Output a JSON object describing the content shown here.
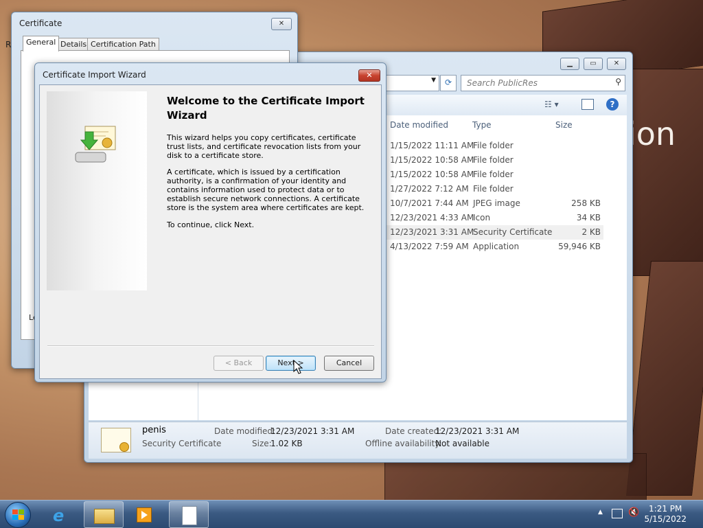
{
  "wallpaper": {
    "text": "ion"
  },
  "explorer": {
    "search_placeholder": "Search PublicRes",
    "columns": {
      "date": "Date modified",
      "type": "Type",
      "size": "Size"
    },
    "rows": [
      {
        "date": "1/15/2022 11:11 AM",
        "type": "File folder",
        "size": ""
      },
      {
        "date": "1/15/2022 10:58 AM",
        "type": "File folder",
        "size": ""
      },
      {
        "date": "1/15/2022 10:58 AM",
        "type": "File folder",
        "size": ""
      },
      {
        "date": "1/27/2022 7:12 AM",
        "type": "File folder",
        "size": ""
      },
      {
        "date": "10/7/2021 7:44 AM",
        "type": "JPEG image",
        "size": "258 KB"
      },
      {
        "date": "12/23/2021 4:33 AM",
        "type": "Icon",
        "size": "34 KB"
      },
      {
        "date": "12/23/2021 3:31 AM",
        "type": "Security Certificate",
        "size": "2 KB"
      },
      {
        "date": "4/13/2022 7:59 AM",
        "type": "Application",
        "size": "59,946 KB"
      }
    ],
    "details": {
      "name": "penis",
      "type": "Security Certificate",
      "date_modified_label": "Date modified:",
      "date_modified": "12/23/2021 3:31 AM",
      "size_label": "Size:",
      "size": "1.02 KB",
      "date_created_label": "Date created:",
      "date_created": "12/23/2021 3:31 AM",
      "offline_label": "Offline availability:",
      "offline": "Not available"
    }
  },
  "cert_dialog": {
    "title": "Certificate",
    "tabs": [
      "General",
      "Details",
      "Certification Path"
    ],
    "partial_label": "Le",
    "edge_label": "R"
  },
  "wizard": {
    "title": "Certificate Import Wizard",
    "heading": "Welcome to the Certificate Import Wizard",
    "p1": "This wizard helps you copy certificates, certificate trust lists, and certificate revocation lists from your disk to a certificate store.",
    "p2": "A certificate, which is issued by a certification authority, is a confirmation of your identity and contains information used to protect data or to establish secure network connections. A certificate store is the system area where certificates are kept.",
    "p3": "To continue, click Next.",
    "back": "< Back",
    "next": "Next >",
    "cancel": "Cancel"
  },
  "taskbar": {
    "time": "1:21 PM",
    "date": "5/15/2022"
  }
}
